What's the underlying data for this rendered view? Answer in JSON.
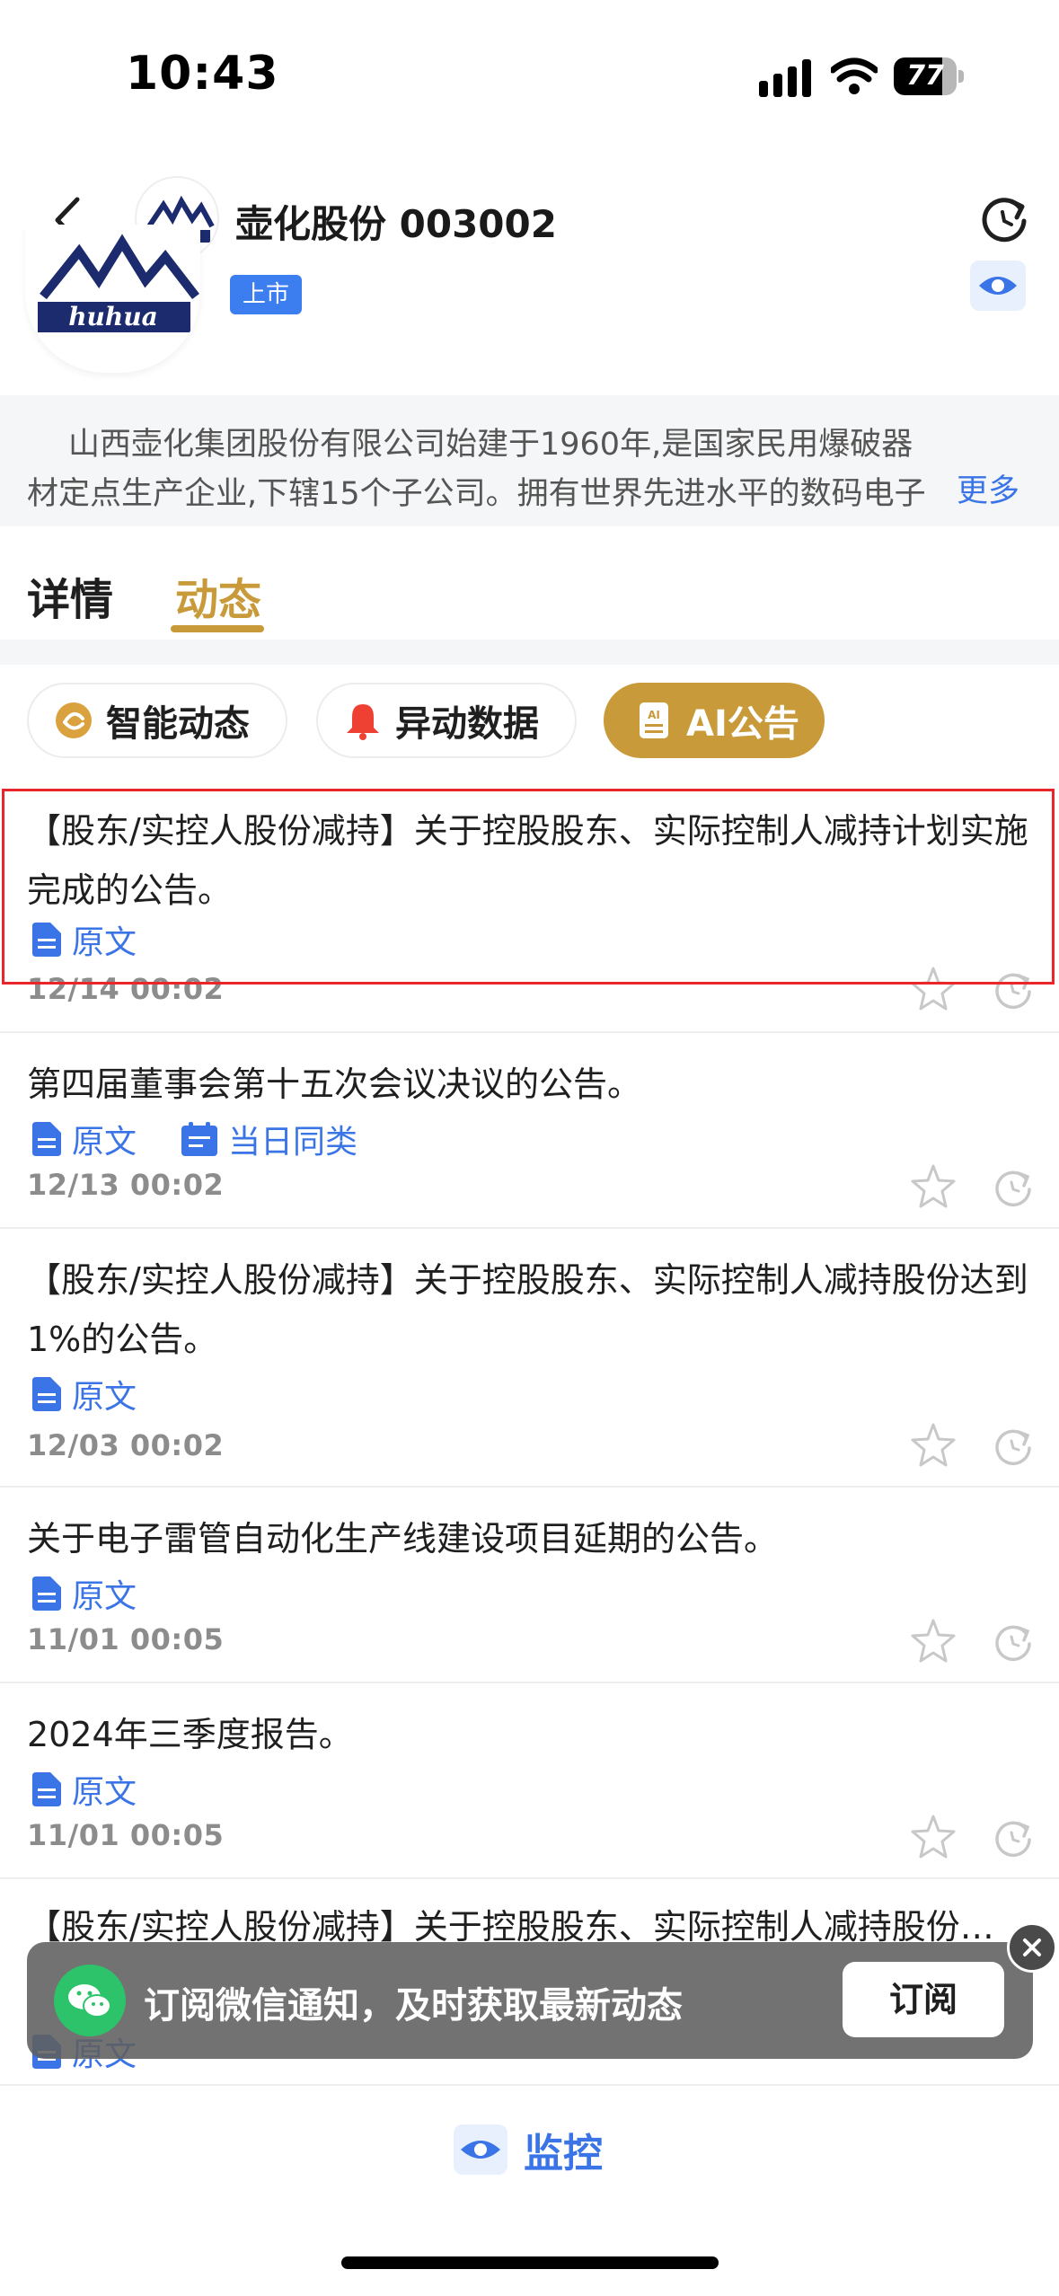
{
  "status_bar": {
    "time": "10:43",
    "battery": "77",
    "battery_level": 0.77
  },
  "header": {
    "title": "壶化股份 003002",
    "listed_badge": "上市"
  },
  "company": {
    "description": "山西壶化集团股份有限公司始建于1960年,是国家民用爆破器材定点生产企业,下辖15个子公司。拥有世界先进水平的数码电子雷管…",
    "more": "更多"
  },
  "tabs": [
    {
      "label": "详情",
      "active": false
    },
    {
      "label": "动态",
      "active": true
    }
  ],
  "filters": [
    {
      "label": "智能动态",
      "icon": "smart-dynamic-icon",
      "active": false
    },
    {
      "label": "异动数据",
      "icon": "bell-icon",
      "active": false
    },
    {
      "label": "AI公告",
      "icon": "ai-document-icon",
      "active": true
    }
  ],
  "announcements": [
    {
      "title": "【股东/实控人股份减持】关于控股股东、实际控制人减持计划实施完成的公告。",
      "links": [
        "原文"
      ],
      "time": "12/14 00:02"
    },
    {
      "title": "第四届董事会第十五次会议决议的公告。",
      "links": [
        "原文",
        "当日同类"
      ],
      "time": "12/13 00:02"
    },
    {
      "title": "【股东/实控人股份减持】关于控股股东、实际控制人减持股份达到1%的公告。",
      "links": [
        "原文"
      ],
      "time": "12/03 00:02"
    },
    {
      "title": "关于电子雷管自动化生产线建设项目延期的公告。",
      "links": [
        "原文"
      ],
      "time": "11/01 00:05"
    },
    {
      "title": "2024年三季度报告。",
      "links": [
        "原文"
      ],
      "time": "11/01 00:05"
    },
    {
      "title": "【股东/实控人股份减持】关于控股股东、实际控制人减持股份…",
      "links": [
        "原文"
      ],
      "time": ""
    }
  ],
  "toast": {
    "text": "订阅微信通知，及时获取最新动态",
    "button": "订阅"
  },
  "bottom": {
    "monitor_label": "监控"
  },
  "colors": {
    "accent_gold": "#c89a3a",
    "link_blue": "#3a74e6",
    "highlight_red": "#e8262b"
  }
}
